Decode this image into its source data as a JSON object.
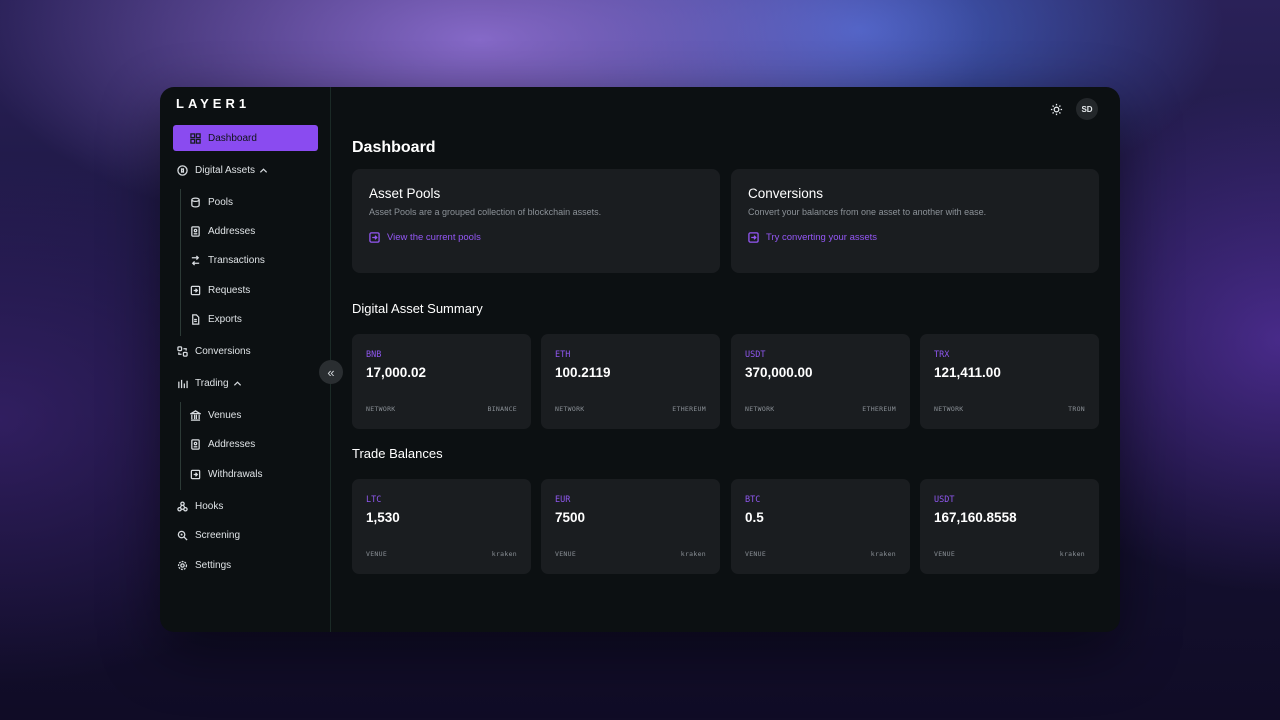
{
  "app": {
    "logo": "LAYER1"
  },
  "sidebar": {
    "dashboard": "Dashboard",
    "digital_assets": "Digital Assets",
    "pools": "Pools",
    "addresses": "Addresses",
    "transactions": "Transactions",
    "requests": "Requests",
    "exports": "Exports",
    "conversions": "Conversions",
    "trading": "Trading",
    "venues": "Venues",
    "trading_addresses": "Addresses",
    "withdrawals": "Withdrawals",
    "hooks": "Hooks",
    "screening": "Screening",
    "settings": "Settings",
    "collapse_icon": "«"
  },
  "header": {
    "avatar": "SD",
    "theme_icon": "sun-icon"
  },
  "main": {
    "title": "Dashboard",
    "asset_pools": {
      "title": "Asset Pools",
      "desc": "Asset Pools are a grouped collection of blockchain assets.",
      "link": "View the current pools"
    },
    "conversions": {
      "title": "Conversions",
      "desc": "Convert your balances from one asset to another with ease.",
      "link": "Try converting your assets"
    },
    "summary_title": "Digital Asset Summary",
    "summary": [
      {
        "symbol": "BNB",
        "value": "17,000.02",
        "label": "NETWORK",
        "network": "BINANCE"
      },
      {
        "symbol": "ETH",
        "value": "100.2119",
        "label": "NETWORK",
        "network": "ETHEREUM"
      },
      {
        "symbol": "USDT",
        "value": "370,000.00",
        "label": "NETWORK",
        "network": "ETHEREUM"
      },
      {
        "symbol": "TRX",
        "value": "121,411.00",
        "label": "NETWORK",
        "network": "TRON"
      }
    ],
    "trade_title": "Trade Balances",
    "trade": [
      {
        "symbol": "LTC",
        "value": "1,530",
        "label": "VENUE",
        "venue": "kraken"
      },
      {
        "symbol": "EUR",
        "value": "7500",
        "label": "VENUE",
        "venue": "kraken"
      },
      {
        "symbol": "BTC",
        "value": "0.5",
        "label": "VENUE",
        "venue": "kraken"
      },
      {
        "symbol": "USDT",
        "value": "167,160.8558",
        "label": "VENUE",
        "venue": "kraken"
      }
    ]
  },
  "colors": {
    "accent": "#8a4bf0",
    "panel": "#0c1012",
    "card": "#1a1d20"
  }
}
